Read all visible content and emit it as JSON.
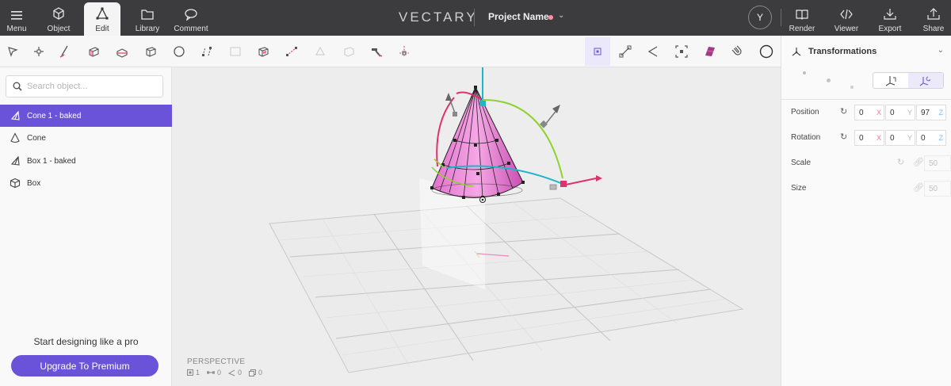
{
  "topbar": {
    "menu_label": "Menu",
    "tabs": [
      {
        "label": "Object",
        "icon": "cube-icon"
      },
      {
        "label": "Edit",
        "icon": "vertex-edit-icon"
      },
      {
        "label": "Library",
        "icon": "folder-icon"
      },
      {
        "label": "Comment",
        "icon": "comment-icon"
      }
    ],
    "active_tab": "Edit",
    "logo": "VECTARY",
    "project_name": "Project Name",
    "avatar_initial": "Y",
    "actions": [
      {
        "label": "Render",
        "icon": "book-icon"
      },
      {
        "label": "Viewer",
        "icon": "code-icon"
      },
      {
        "label": "Export",
        "icon": "download-icon"
      },
      {
        "label": "Share",
        "icon": "share-icon"
      }
    ]
  },
  "toolbar": {
    "tools": [
      "select-icon",
      "add-vertex-icon",
      "draw-icon",
      "extrude-icon",
      "slice-icon",
      "bevel-icon",
      "subdivide-icon",
      "split-icon",
      "fill-icon",
      "inset-icon",
      "bridge-icon",
      "flip-icon",
      "solidify-icon",
      "weld-icon",
      "move-to-icon"
    ],
    "mode_tools": [
      "vertex-mode-icon",
      "edge-mode-icon",
      "face-mode-icon",
      "pivot-icon",
      "material-icon",
      "magnet-icon",
      "sphere-icon"
    ]
  },
  "left_panel": {
    "search_placeholder": "Search object...",
    "objects": [
      {
        "label": "Cone 1 - baked",
        "icon": "baked-mesh-icon",
        "selected": true
      },
      {
        "label": "Cone",
        "icon": "cone-icon",
        "selected": false
      },
      {
        "label": "Box 1 - baked",
        "icon": "baked-mesh-icon",
        "selected": false
      },
      {
        "label": "Box",
        "icon": "box-icon",
        "selected": false
      }
    ],
    "promo_text": "Start designing like a pro",
    "upgrade_label": "Upgrade To Premium"
  },
  "viewport": {
    "camera_label": "PERSPECTIVE",
    "stats": [
      {
        "icon": "object-count-icon",
        "value": "1"
      },
      {
        "icon": "edge-count-icon",
        "value": "0"
      },
      {
        "icon": "face-count-icon",
        "value": "0"
      },
      {
        "icon": "copy-count-icon",
        "value": "0"
      }
    ]
  },
  "right_panel": {
    "title": "Transformations",
    "rows": [
      {
        "label": "Position",
        "x": "0",
        "y": "0",
        "z": "97"
      },
      {
        "label": "Rotation",
        "x": "0",
        "y": "0",
        "z": "0"
      },
      {
        "label": "Scale",
        "value": "50"
      },
      {
        "label": "Size",
        "value": "50"
      }
    ],
    "axis_labels": {
      "x": "X",
      "y": "Y",
      "z": "Z"
    },
    "colors": {
      "x": "#ff6b8a",
      "y": "#b7b7b7",
      "z": "#6ec0ff",
      "accent": "#6a53d8"
    }
  }
}
